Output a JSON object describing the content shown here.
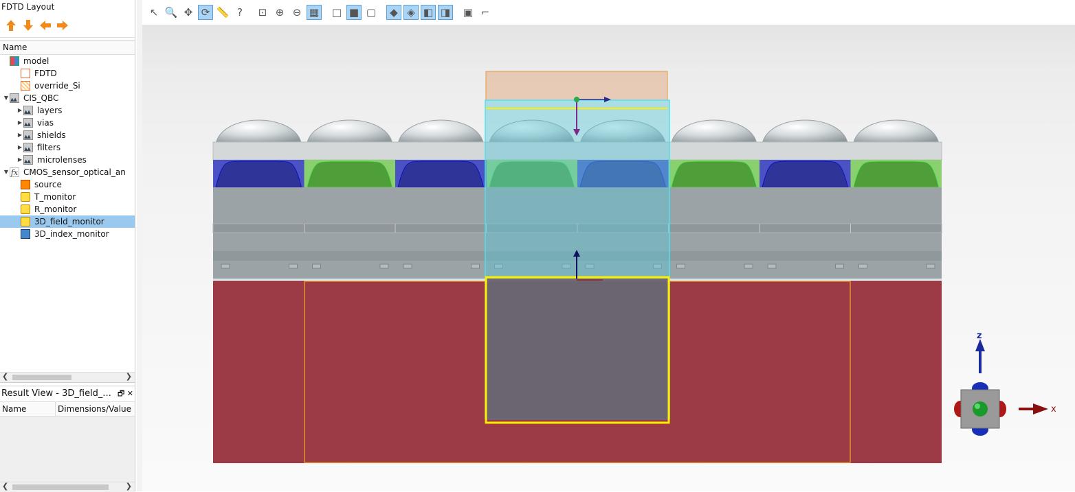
{
  "layout_panel": {
    "title": "FDTD Layout",
    "arrows": [
      "arrow-up-icon",
      "arrow-down-icon",
      "arrow-left-icon",
      "arrow-right-icon"
    ],
    "column_header": "Name"
  },
  "tree": [
    {
      "label": "model",
      "icon": "model-icon",
      "level": 0,
      "expander": ""
    },
    {
      "label": "FDTD",
      "icon": "fdtd-icon",
      "level": 1,
      "expander": ""
    },
    {
      "label": "override_Si",
      "icon": "mesh-override-icon",
      "level": 1,
      "expander": ""
    },
    {
      "label": "CIS_QBC",
      "icon": "structure-group-icon",
      "level": 0,
      "expander": "▼"
    },
    {
      "label": "layers",
      "icon": "structure-group-icon",
      "level": 1,
      "expander": "▶"
    },
    {
      "label": "vias",
      "icon": "structure-group-icon",
      "level": 1,
      "expander": "▶"
    },
    {
      "label": "shields",
      "icon": "structure-group-icon",
      "level": 1,
      "expander": "▶"
    },
    {
      "label": "filters",
      "icon": "structure-group-icon",
      "level": 1,
      "expander": "▶"
    },
    {
      "label": "microlenses",
      "icon": "structure-group-icon",
      "level": 1,
      "expander": "▶"
    },
    {
      "label": "CMOS_sensor_optical_an",
      "icon": "analysis-group-icon",
      "level": 0,
      "expander": "▼"
    },
    {
      "label": "source",
      "icon": "source-icon",
      "level": 1,
      "expander": ""
    },
    {
      "label": "T_monitor",
      "icon": "monitor-icon",
      "level": 1,
      "expander": ""
    },
    {
      "label": "R_monitor",
      "icon": "monitor-icon",
      "level": 1,
      "expander": ""
    },
    {
      "label": "3D_field_monitor",
      "icon": "monitor-icon",
      "level": 1,
      "expander": "",
      "selected": true
    },
    {
      "label": "3D_index_monitor",
      "icon": "index-monitor-icon",
      "level": 1,
      "expander": ""
    }
  ],
  "result_view": {
    "title": "Result View - 3D_field_...",
    "col_name": "Name",
    "col_value": "Dimensions/Value",
    "restore_glyph": "🗗",
    "close_glyph": "✕"
  },
  "toolbar": [
    {
      "name": "select-icon",
      "glyph": "↖",
      "active": false
    },
    {
      "name": "zoom-region-icon",
      "glyph": "🔍",
      "active": false
    },
    {
      "name": "pan-icon",
      "glyph": "✥",
      "active": false
    },
    {
      "name": "rotate-icon",
      "glyph": "⟳",
      "active": true
    },
    {
      "name": "ruler-icon",
      "glyph": "📏",
      "active": false
    },
    {
      "name": "help-icon",
      "glyph": "?",
      "active": false
    },
    {
      "name": "zoom-extent-icon",
      "glyph": "⊡",
      "active": false
    },
    {
      "name": "zoom-in-icon",
      "glyph": "⊕",
      "active": false
    },
    {
      "name": "zoom-out-icon",
      "glyph": "⊖",
      "active": false
    },
    {
      "name": "toggle-grid-icon",
      "glyph": "▦",
      "active": true
    },
    {
      "name": "view-box-icon",
      "glyph": "□",
      "active": false
    },
    {
      "name": "view-solid-icon",
      "glyph": "■",
      "active": true
    },
    {
      "name": "view-wireframe-icon",
      "glyph": "▢",
      "active": false
    },
    {
      "name": "view-perspective-icon",
      "glyph": "◆",
      "active": true
    },
    {
      "name": "view-xy-icon",
      "glyph": "◈",
      "active": true
    },
    {
      "name": "view-xz-icon",
      "glyph": "◧",
      "active": true
    },
    {
      "name": "view-yz-icon",
      "glyph": "◨",
      "active": true
    },
    {
      "name": "cube-icon",
      "glyph": "▣",
      "active": false
    },
    {
      "name": "ruler-vertical-icon",
      "glyph": "⌐",
      "active": false
    }
  ],
  "axes": {
    "z_label": "z",
    "x_label": "x"
  },
  "colors": {
    "substrate": "#9c3a46",
    "blue_filter": "#2f3499",
    "green_filter": "#4e9e3a",
    "monitor_cyan": "#50e0f0",
    "highlight_yellow": "#ffee00",
    "source_orange": "#e89030"
  }
}
